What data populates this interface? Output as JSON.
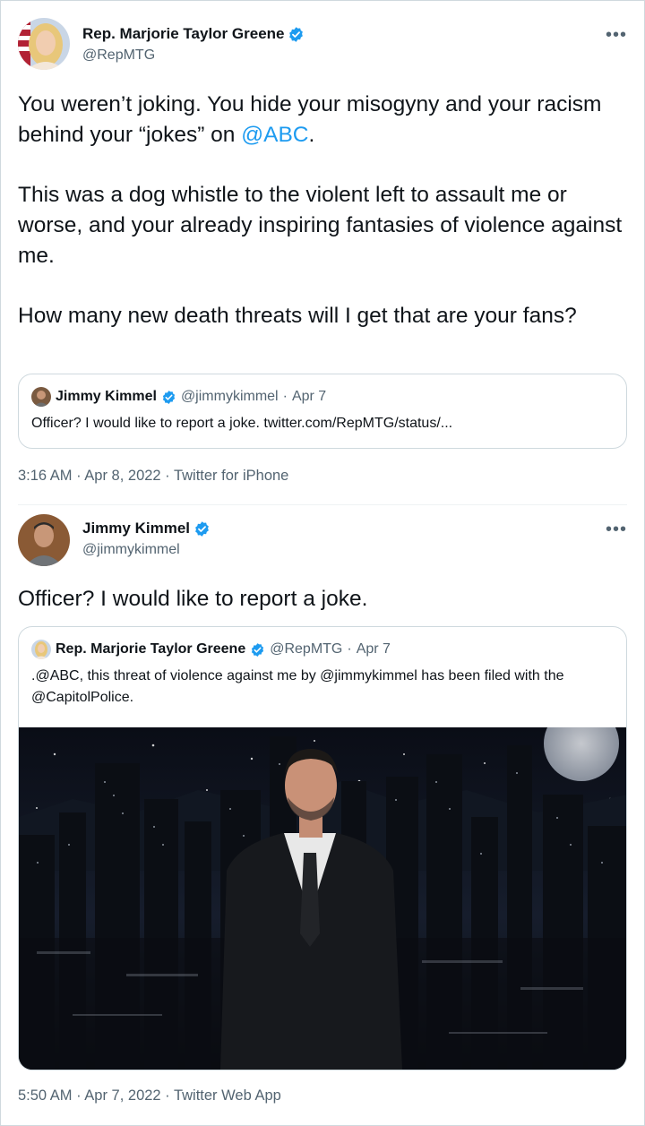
{
  "tweet1": {
    "author_name": "Rep. Marjorie Taylor Greene",
    "author_handle": "@RepMTG",
    "more_label": "•••",
    "paragraph1_before": "You weren’t joking. You hide your misogyny and your racism behind your “jokes” on ",
    "paragraph1_link": "@ABC",
    "paragraph1_after": ".",
    "paragraph2": "This was a dog whistle to the violent left to assault me or worse, and your already inspiring fantasies of violence against me.",
    "paragraph3": "How many new death threats will I get that are your fans?",
    "quote": {
      "author_name": "Jimmy Kimmel",
      "author_handle": "@jimmykimmel",
      "separator": "·",
      "date": "Apr 7",
      "text": "Officer?  I would like to report a joke. twitter.com/RepMTG/status/..."
    },
    "footer": "3:16 AM · Apr 8, 2022 · Twitter for iPhone"
  },
  "tweet2": {
    "author_name": "Jimmy Kimmel",
    "author_handle": "@jimmykimmel",
    "more_label": "•••",
    "text": "Officer?  I would like to report a joke.",
    "quote": {
      "author_name": "Rep. Marjorie Taylor Greene",
      "author_handle": "@RepMTG",
      "separator": "·",
      "date": "Apr 7",
      "text": ".@ABC, this threat of violence against me by @jimmykimmel has been filed with the @CapitolPolice."
    },
    "footer": "5:50 AM · Apr 7, 2022 · Twitter Web App"
  },
  "colors": {
    "accent": "#1d9bf0",
    "secondary_text": "#536471",
    "border": "#cfd9de"
  },
  "icons": {
    "verified": "verified-badge-icon",
    "more": "more-options-icon"
  }
}
